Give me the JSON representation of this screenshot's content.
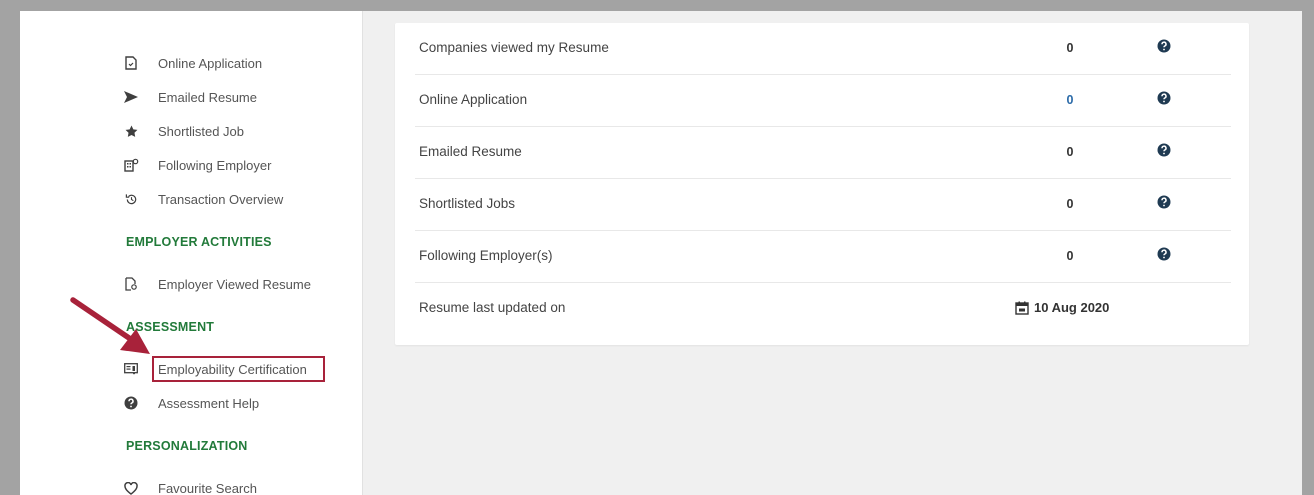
{
  "sidebar": {
    "items_top": [
      {
        "label": "Online Application",
        "icon": "document-icon"
      },
      {
        "label": "Emailed Resume",
        "icon": "send-icon"
      },
      {
        "label": "Shortlisted Job",
        "icon": "star-icon"
      },
      {
        "label": "Following Employer",
        "icon": "building-icon"
      },
      {
        "label": "Transaction Overview",
        "icon": "history-icon"
      }
    ],
    "employer_activities": {
      "heading": "EMPLOYER ACTIVITIES",
      "items": [
        {
          "label": "Employer Viewed Resume",
          "icon": "document-search-icon"
        }
      ]
    },
    "assessment": {
      "heading": "ASSESSMENT",
      "items": [
        {
          "label": "Employability Certification",
          "icon": "certificate-icon"
        },
        {
          "label": "Assessment Help",
          "icon": "help-circle-icon"
        }
      ]
    },
    "personalization": {
      "heading": "PERSONALIZATION",
      "items": [
        {
          "label": "Favourite Search",
          "icon": "heart-icon"
        }
      ]
    }
  },
  "summary": {
    "rows": [
      {
        "label": "Companies viewed my Resume",
        "value": "0"
      },
      {
        "label": "Online Application",
        "value": "0"
      },
      {
        "label": "Emailed Resume",
        "value": "0"
      },
      {
        "label": "Shortlisted Jobs",
        "value": "0"
      },
      {
        "label": "Following Employer(s)",
        "value": "0"
      }
    ],
    "last_updated": {
      "label": "Resume last updated on",
      "date": "10 Aug 2020"
    }
  },
  "colors": {
    "section_heading": "#227a3a",
    "highlight_box": "#a8223a",
    "link_value": "#2a6aa8",
    "help_icon": "#1f3a52"
  }
}
